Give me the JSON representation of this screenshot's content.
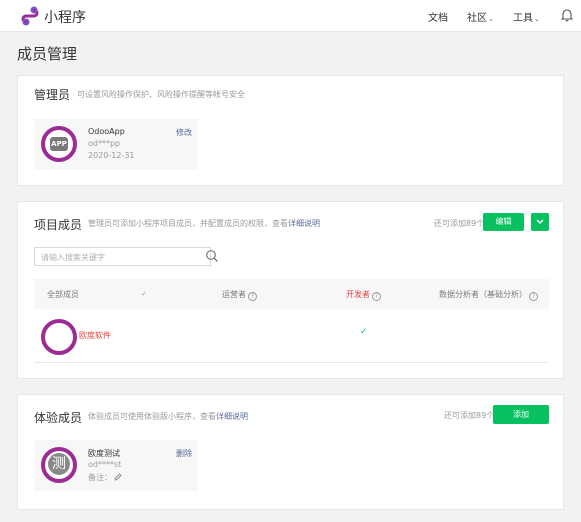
{
  "topbar": {
    "brand": "小程序",
    "nav": {
      "docs": "文档",
      "community": "社区",
      "tools": "工具"
    },
    "icons": {
      "logo": "miniprogram-logo-icon",
      "bell": "bell-icon"
    }
  },
  "page": {
    "title": "成员管理"
  },
  "admin": {
    "title": "管理员",
    "desc": "可设置风险操作保护、风险操作提醒等帐号安全",
    "person": {
      "name": "OdooApp",
      "id": "od***pp",
      "date": "2020-12-31",
      "badge": "APP",
      "action": "修改"
    }
  },
  "members": {
    "title": "项目成员",
    "desc": "管理员可添加小程序项目成员，并配置成员的权限，查看",
    "desc_link": "详细说明",
    "quota": "还可添加89个",
    "edit_button": "编辑",
    "search": {
      "placeholder": "请输入搜索关键字"
    },
    "columns": {
      "all": "全部成员",
      "ops": "运营者",
      "dev": "开发者",
      "analyst": "数据分析者（基础分析）"
    },
    "help_glyph": "?",
    "rows": [
      {
        "name": "欧度软件",
        "ops": false,
        "dev": true,
        "analyst": false
      }
    ]
  },
  "testers": {
    "title": "体验成员",
    "desc": "体验成员可使用体验版小程序，查看",
    "desc_link": "详细说明",
    "quota": "还可添加89个",
    "add_button": "添加",
    "person": {
      "name": "欧度测试",
      "id": "od****st",
      "note_label": "备注：",
      "avatar_char": "测",
      "action": "删除"
    }
  },
  "colors": {
    "accent": "#07c160",
    "link": "#576b95",
    "avatar_ring": "#9b2c96",
    "developer": "#e64340"
  }
}
